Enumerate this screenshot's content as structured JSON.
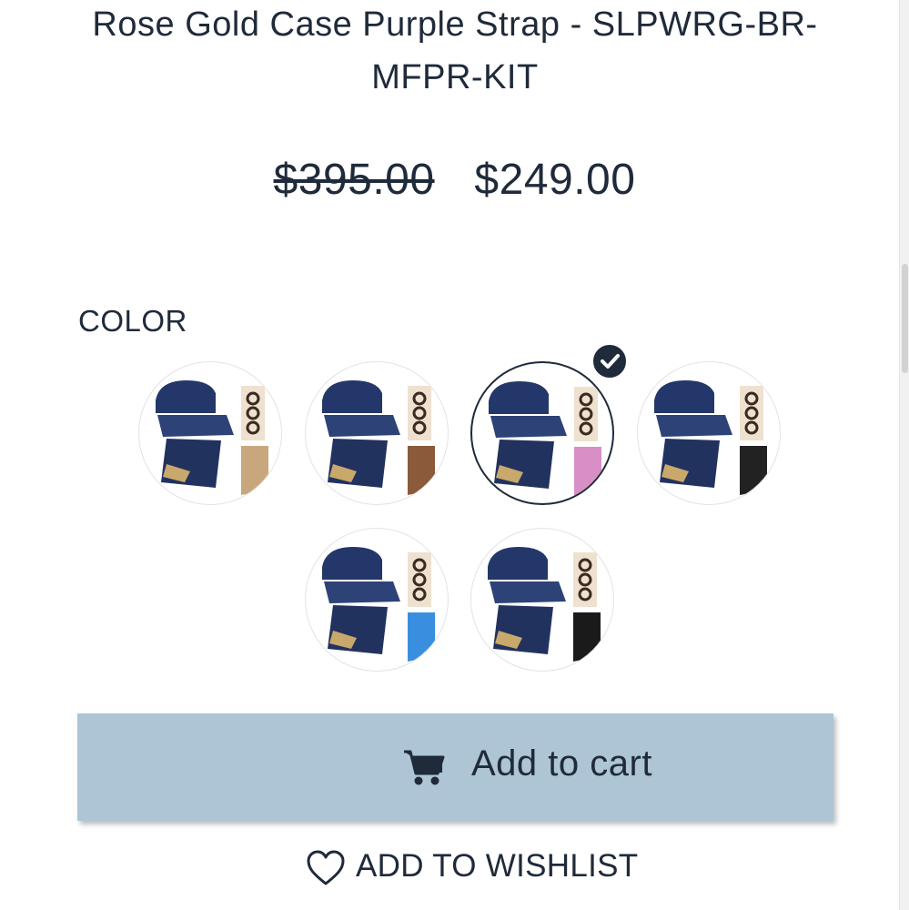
{
  "product": {
    "title_line1": "Rose Gold Case Purple Strap - SLPWRG-BR-",
    "title_line2": "MFPR-KIT",
    "price_original": "$395.00",
    "price_sale": "$249.00"
  },
  "options": {
    "label": "COLOR",
    "selected_index": 2,
    "swatches": [
      {
        "accent": "#c9a77c",
        "icon": "strap-swatch-tan"
      },
      {
        "accent": "#8a5a3a",
        "icon": "strap-swatch-brown"
      },
      {
        "accent": "#d98fc6",
        "icon": "strap-swatch-purple"
      },
      {
        "accent": "#222222",
        "icon": "strap-swatch-black"
      },
      {
        "accent": "#3a8ee0",
        "icon": "strap-swatch-blue"
      },
      {
        "accent": "#1a1a1a",
        "icon": "strap-swatch-dark"
      }
    ]
  },
  "actions": {
    "add_to_cart": "Add to cart",
    "add_to_wishlist": "ADD TO WISHLIST"
  },
  "colors": {
    "text": "#1f2a3a",
    "button_bg": "#adc5d4"
  }
}
